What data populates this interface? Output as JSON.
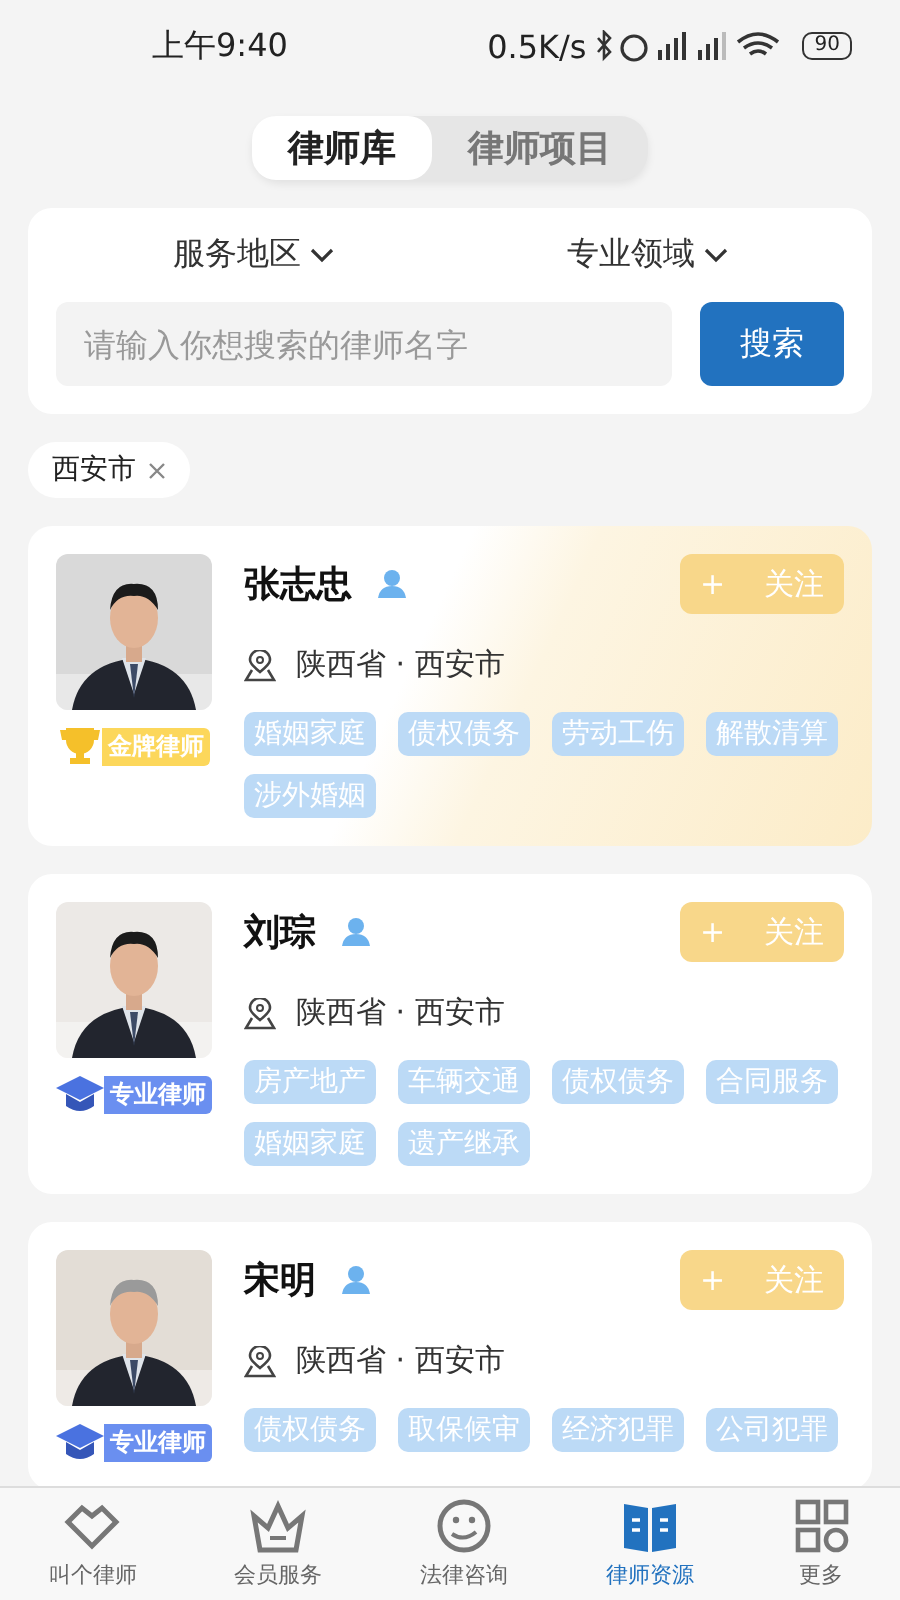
{
  "status_bar": {
    "time": "上午9:40",
    "speed": "0.5K/s",
    "battery": "90"
  },
  "tabs": [
    {
      "label": "律师库",
      "selected": true
    },
    {
      "label": "律师项目",
      "selected": false
    }
  ],
  "filters": [
    {
      "label": "服务地区"
    },
    {
      "label": "专业领域"
    }
  ],
  "search": {
    "placeholder": "请输入你想搜索的律师名字",
    "button": "搜索"
  },
  "active_filters": [
    {
      "label": "西安市"
    }
  ],
  "lawyers": [
    {
      "name": "张志忠",
      "location": "陕西省 · 西安市",
      "follow_plus": "+",
      "follow_label": "关注",
      "badge": {
        "kind": "gold",
        "label": "金牌律师"
      },
      "tags": [
        "婚姻家庭",
        "债权债务",
        "劳动工伤",
        "解散清算",
        "涉外婚姻"
      ]
    },
    {
      "name": "刘琮",
      "location": "陕西省 · 西安市",
      "follow_plus": "+",
      "follow_label": "关注",
      "badge": {
        "kind": "pro",
        "label": "专业律师"
      },
      "tags": [
        "房产地产",
        "车辆交通",
        "债权债务",
        "合同服务",
        "婚姻家庭",
        "遗产继承"
      ]
    },
    {
      "name": "宋明",
      "location": "陕西省 · 西安市",
      "follow_plus": "+",
      "follow_label": "关注",
      "badge": {
        "kind": "pro",
        "label": "专业律师"
      },
      "tags": [
        "债权债务",
        "取保候审",
        "经济犯罪",
        "公司犯罪"
      ]
    }
  ],
  "nav": [
    {
      "label": "叫个律师",
      "selected": false
    },
    {
      "label": "会员服务",
      "selected": false
    },
    {
      "label": "法律咨询",
      "selected": false
    },
    {
      "label": "律师资源",
      "selected": true
    },
    {
      "label": "更多",
      "selected": false
    }
  ]
}
